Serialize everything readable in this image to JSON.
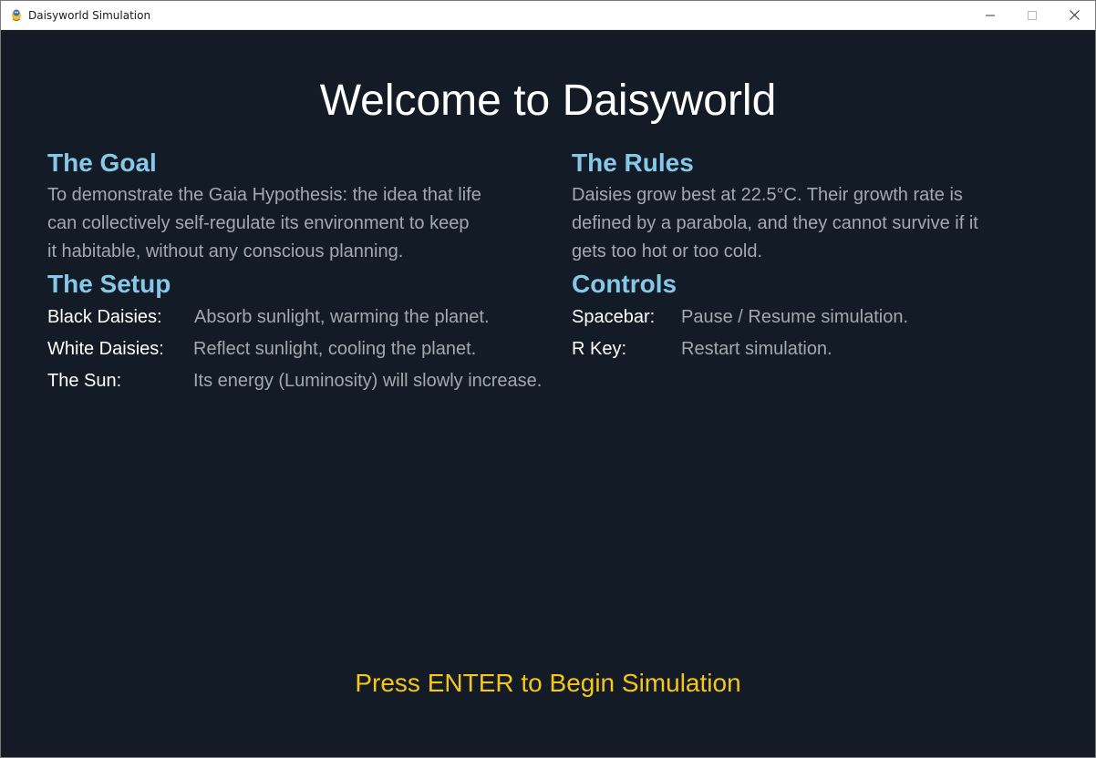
{
  "window": {
    "title": "Daisyworld Simulation",
    "icon": "pygame-snake-icon"
  },
  "colors": {
    "background": "#131c26",
    "heading": "#ffffff",
    "section_title": "#87c8e8",
    "body_text": "#a2a8ae",
    "label_text": "#ffffff",
    "prompt": "#f5c518"
  },
  "heading": "Welcome to Daisyworld",
  "goal": {
    "title": "The Goal",
    "lines": [
      "To demonstrate the Gaia Hypothesis: the idea that life",
      "can collectively self-regulate its environment to keep",
      "it habitable, without any conscious planning."
    ]
  },
  "rules": {
    "title": "The Rules",
    "lines": [
      "Daisies grow best at 22.5°C. Their growth rate is",
      "defined by a parabola, and they cannot survive if it",
      "gets too hot or too cold."
    ]
  },
  "setup": {
    "title": "The Setup",
    "rows": [
      {
        "label": "Black Daisies:",
        "value": "Absorb sunlight, warming the planet."
      },
      {
        "label": "White Daisies:",
        "value": "Reflect sunlight, cooling the planet."
      },
      {
        "label": "The Sun:",
        "value": "Its energy (Luminosity) will slowly increase."
      }
    ]
  },
  "controls": {
    "title": "Controls",
    "rows": [
      {
        "label": "Spacebar:",
        "value": "Pause / Resume simulation."
      },
      {
        "label": "R Key:",
        "value": "Restart simulation."
      }
    ]
  },
  "prompt": "Press ENTER to Begin Simulation"
}
